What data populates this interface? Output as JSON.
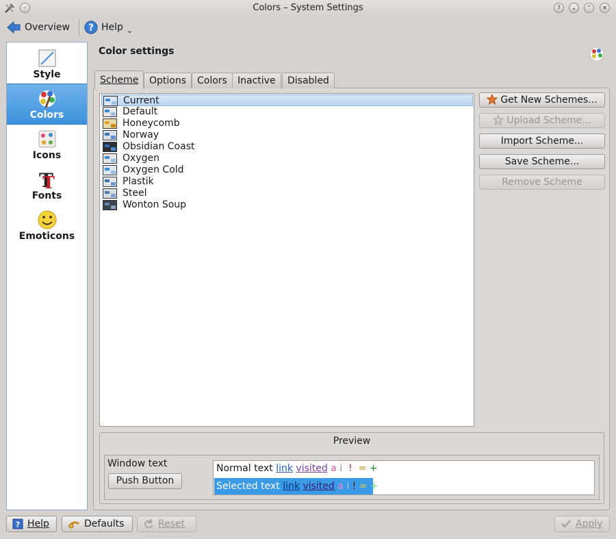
{
  "window": {
    "title": "Colors – System Settings"
  },
  "toolbar": {
    "overview_label": "Overview",
    "help_label": "Help"
  },
  "sidebar": {
    "items": [
      {
        "label": "Style",
        "icon": "style-icon"
      },
      {
        "label": "Colors",
        "icon": "colors-icon"
      },
      {
        "label": "Icons",
        "icon": "icons-icon"
      },
      {
        "label": "Fonts",
        "icon": "fonts-icon"
      },
      {
        "label": "Emoticons",
        "icon": "emoticons-icon"
      }
    ],
    "selected": "Colors"
  },
  "main": {
    "heading": "Color settings",
    "tabs": [
      "Scheme",
      "Options",
      "Colors",
      "Inactive",
      "Disabled"
    ],
    "active_tab": "Scheme",
    "schemes": [
      {
        "name": "Current",
        "c1": "#3a8ad8",
        "c2": "#9bbfe2",
        "bg": "#dbe7f3"
      },
      {
        "name": "Default",
        "c1": "#3a8ad8",
        "c2": "#9bbfe2",
        "bg": "#e6e6e6"
      },
      {
        "name": "Honeycomb",
        "c1": "#e3a12a",
        "c2": "#c88a1c",
        "bg": "#eadca8"
      },
      {
        "name": "Norway",
        "c1": "#3a72b8",
        "c2": "#5b8fd0",
        "bg": "#d8dfe8"
      },
      {
        "name": "Obsidian Coast",
        "c1": "#2e6bb0",
        "c2": "#4a88d0",
        "bg": "#2a2e33"
      },
      {
        "name": "Oxygen",
        "c1": "#3a8ad8",
        "c2": "#9bbfe2",
        "bg": "#e6e6e6"
      },
      {
        "name": "Oxygen Cold",
        "c1": "#3a8ad8",
        "c2": "#9bbfe2",
        "bg": "#dfe6ee"
      },
      {
        "name": "Plastik",
        "c1": "#3d6fb6",
        "c2": "#6a96d2",
        "bg": "#e4e4e4"
      },
      {
        "name": "Steel",
        "c1": "#4f7cb0",
        "c2": "#7fa3c8",
        "bg": "#d8dde2"
      },
      {
        "name": "Wonton Soup",
        "c1": "#6b8ab3",
        "c2": "#8aa3c0",
        "bg": "#3b434e"
      }
    ],
    "selected_scheme": "Current",
    "buttons": {
      "get_new": "Get New Schemes...",
      "upload": "Upload Scheme...",
      "import": "Import Scheme...",
      "save": "Save Scheme...",
      "remove": "Remove Scheme"
    }
  },
  "preview": {
    "title": "Preview",
    "window_text": "Window text",
    "push_button": "Push Button",
    "normal_text": "Normal text",
    "selected_text": "Selected text",
    "link": "link",
    "visited": "visited",
    "active_char": "a",
    "inactive_char": "i",
    "negative_char": "!",
    "neutral_char": "=",
    "positive_char": "+",
    "colors": {
      "link": "#1f5db3",
      "visited": "#7b3fa0",
      "active": "#e05aad",
      "inactive": "#8a8a8a",
      "negative": "#c0262c",
      "neutral": "#c28b00",
      "positive": "#1e8a2f",
      "selection": "#3a9ae6"
    }
  },
  "footer": {
    "help": "Help",
    "defaults": "Defaults",
    "reset": "Reset",
    "apply": "Apply"
  }
}
